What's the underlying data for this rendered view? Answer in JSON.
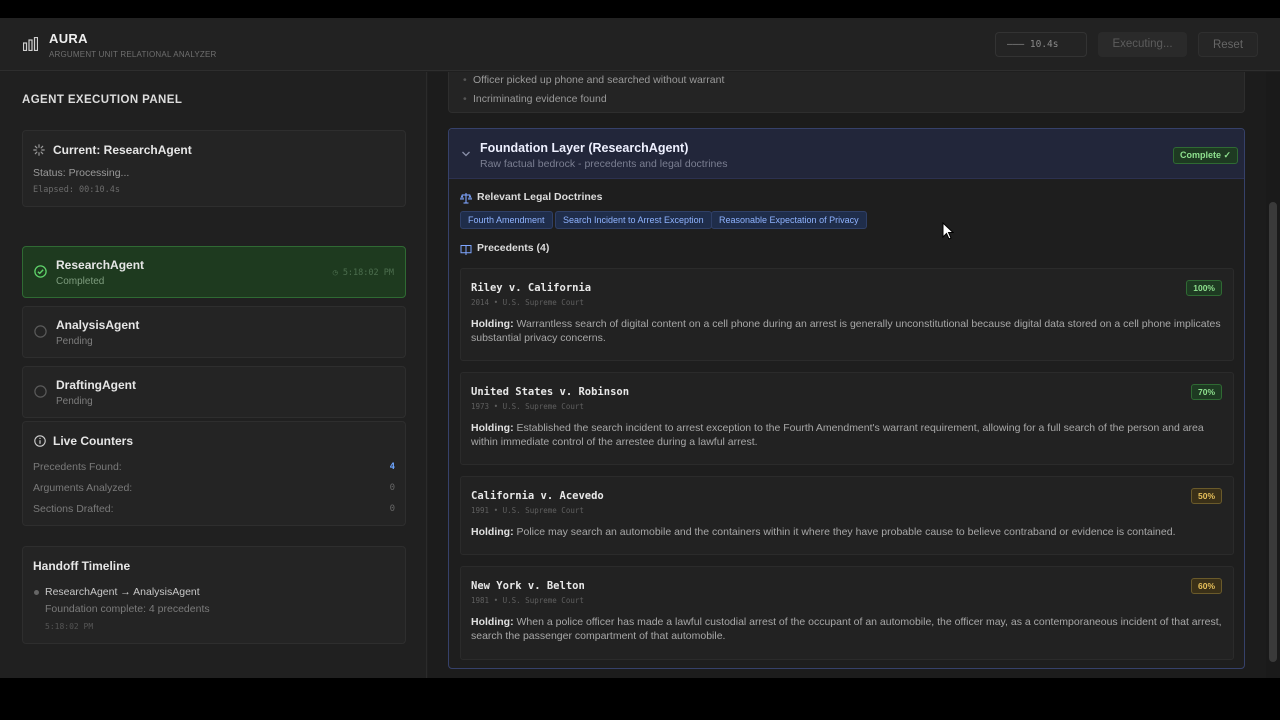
{
  "header": {
    "app_name": "AURA",
    "app_subtitle": "ARGUMENT UNIT RELATIONAL ANALYZER",
    "timer": "——— 10.4s",
    "executing_label": "Executing...",
    "reset_label": "Reset"
  },
  "left_panel": {
    "title": "AGENT EXECUTION PANEL",
    "current": {
      "title": "Current: ResearchAgent",
      "status": "Status: Processing...",
      "elapsed": "Elapsed: 00:10.4s"
    },
    "agents": [
      {
        "name": "ResearchAgent",
        "status": "Completed",
        "time": "5:18:02 PM"
      },
      {
        "name": "AnalysisAgent",
        "status": "Pending"
      },
      {
        "name": "DraftingAgent",
        "status": "Pending"
      }
    ],
    "counters": {
      "title": "Live Counters",
      "items": [
        {
          "label": "Precedents Found:",
          "value": "4"
        },
        {
          "label": "Arguments Analyzed:",
          "value": "0"
        },
        {
          "label": "Sections Drafted:",
          "value": "0"
        }
      ]
    },
    "handoff": {
      "title": "Handoff Timeline",
      "event": "ResearchAgent → AnalysisAgent",
      "detail": "Foundation complete: 4 precedents",
      "time": "5:18:02 PM"
    }
  },
  "facts": [
    "Officer picked up phone and searched without warrant",
    "Incriminating evidence found"
  ],
  "layer": {
    "title": "Foundation Layer (ResearchAgent)",
    "subtitle": "Raw factual bedrock - precedents and legal doctrines",
    "badge": "Complete ✓",
    "doctrines_title": "Relevant Legal Doctrines",
    "doctrines": [
      "Fourth Amendment",
      "Search Incident to Arrest Exception",
      "Reasonable Expectation of Privacy"
    ],
    "precedents_title": "Precedents (4)",
    "holding_label": "Holding:",
    "precedents": [
      {
        "name": "Riley v. California",
        "meta": "2014 • U.S. Supreme Court",
        "score": "100%",
        "holding": " Warrantless search of digital content on a cell phone during an arrest is generally unconstitutional because digital data stored on a cell phone implicates substantial privacy concerns."
      },
      {
        "name": "United States v. Robinson",
        "meta": "1973 • U.S. Supreme Court",
        "score": "70%",
        "holding": " Established the search incident to arrest exception to the Fourth Amendment's warrant requirement, allowing for a full search of the person and area within immediate control of the arrestee during a lawful arrest."
      },
      {
        "name": "California v. Acevedo",
        "meta": "1991 • U.S. Supreme Court",
        "score": "50%",
        "holding": " Police may search an automobile and the containers within it where they have probable cause to believe contraband or evidence is contained."
      },
      {
        "name": "New York v. Belton",
        "meta": "1981 • U.S. Supreme Court",
        "score": "60%",
        "holding": " When a police officer has made a lawful custodial arrest of the occupant of an automobile, the officer may, as a contemporaneous incident of that arrest, search the passenger compartment of that automobile."
      }
    ]
  },
  "colors": {
    "accent_blue": "#6ea6ff",
    "success_green": "#8ee08e",
    "amber": "#e8c05a"
  }
}
